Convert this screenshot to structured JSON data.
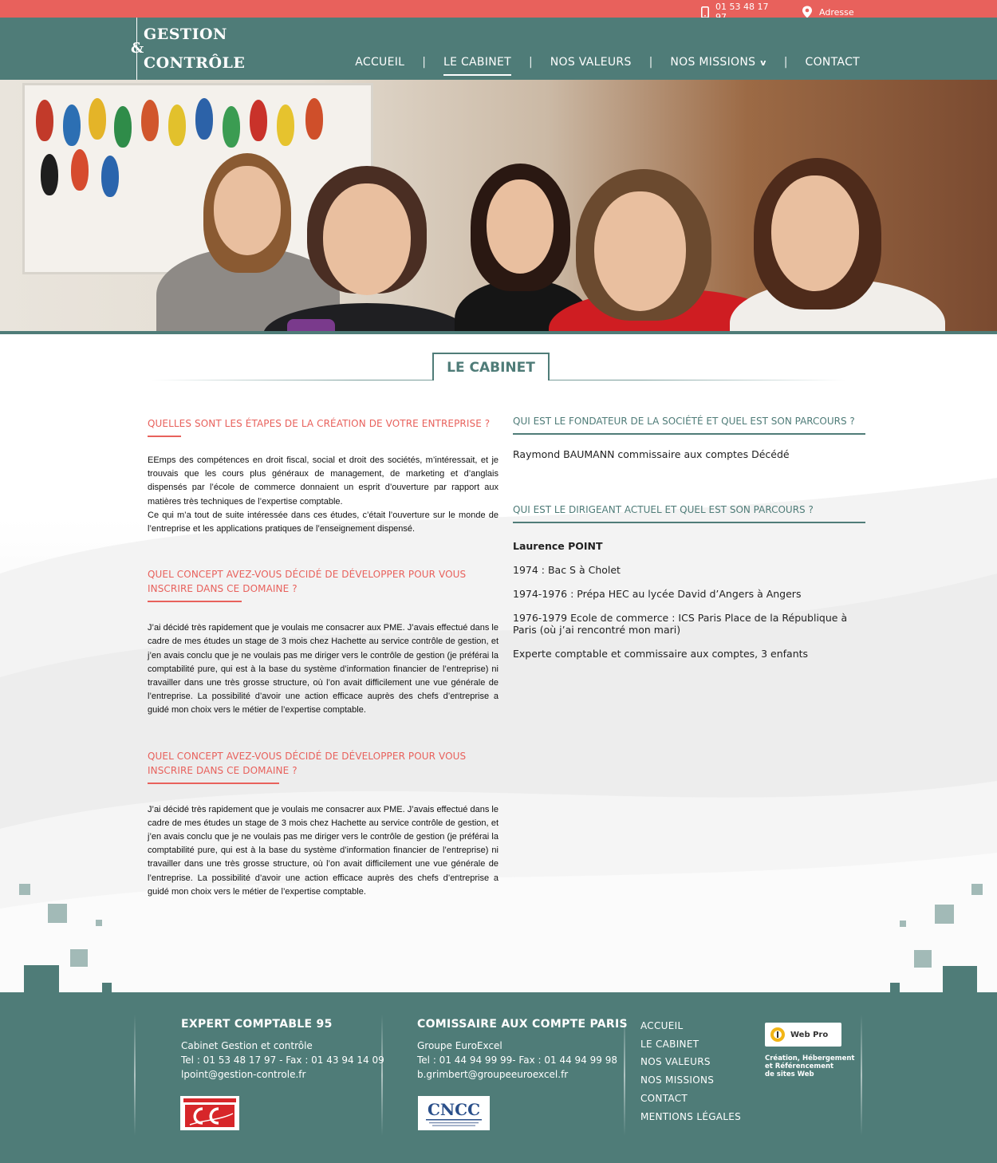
{
  "colors": {
    "accent_red": "#e8615c",
    "brand_teal": "#4f7c78"
  },
  "topbar": {
    "phone": "01 53 48 17 97",
    "address_label": "Adresse",
    "phone_icon": "mobile-phone-icon",
    "address_icon": "map-pin-icon"
  },
  "logo": {
    "line1": "GESTION",
    "amp": "&",
    "line2": "CONTRÔLE"
  },
  "nav": {
    "items": [
      {
        "label": "ACCUEIL"
      },
      {
        "label": "LE CABINET"
      },
      {
        "label": "NOS VALEURS"
      },
      {
        "label": "NOS MISSIONS"
      },
      {
        "label": "CONTACT"
      }
    ],
    "separator": "|",
    "dropdown_caret": "v",
    "active": "LE CABINET"
  },
  "section": {
    "title": "LE CABINET"
  },
  "left": {
    "blocks": [
      {
        "question": "QUELLES SONT LES ÉTAPES DE LA CRÉATION DE VOTRE ENTREPRISE ?",
        "text1": "EEmps des compétences en droit fiscal, social et droit des sociétés, m’intéressait, et je trouvais que les cours plus généraux de management, de marketing et d’anglais dispensés par l’école de commerce donnaient un esprit d’ouverture par rapport aux matières très techniques de l’expertise comptable.",
        "text2": "Ce qui m’a tout de suite intéressée dans ces études, c’était l’ouverture sur le monde de l’entreprise et les applications pratiques de l’enseignement dispensé."
      },
      {
        "question": "QUEL CONCEPT AVEZ-VOUS DÉCIDÉ DE DÉVELOPPER POUR VOUS INSCRIRE DANS CE DOMAINE ?",
        "text1": "J’ai décidé très rapidement que je voulais me consacrer aux PME. J’avais effectué dans le cadre de mes études un stage de 3 mois chez Hachette au service contrôle de gestion, et j’en avais conclu que je ne voulais pas me diriger vers le contrôle de gestion (je préférai la comptabilité pure, qui est à la base du système d’information financier de l’entreprise) ni travailler dans une très grosse structure, où l’on avait difficilement une vue générale de l’entreprise. La possibilité d’avoir une action efficace auprès des chefs d’entreprise a guidé mon choix vers le métier de l’expertise comptable."
      },
      {
        "question": "QUEL CONCEPT AVEZ-VOUS DÉCIDÉ DE DÉVELOPPER POUR VOUS INSCRIRE DANS CE DOMAINE ?",
        "text1": "J’ai décidé très rapidement que je voulais me consacrer aux PME. J’avais effectué dans le cadre de mes études un stage de 3 mois chez Hachette au service contrôle de gestion, et j’en avais conclu que je ne voulais pas me diriger vers le contrôle de gestion (je préférai la comptabilité pure, qui est à la base du système d’information financier de l’entreprise) ni travailler dans une très grosse structure, où l’on avait difficilement une vue générale de l’entreprise. La possibilité d’avoir une action efficace auprès des chefs d’entreprise a guidé mon choix vers le métier de l’expertise comptable."
      }
    ]
  },
  "right": {
    "founder_question": "QUI EST LE FONDATEUR DE LA SOCIÉTÉ ET QUEL EST SON PARCOURS ?",
    "founder_text": "Raymond BAUMANN commissaire aux comptes Décédé",
    "leader_question": "QUI EST LE DIRIGEANT ACTUEL ET QUEL EST SON PARCOURS ?",
    "leader_name": "Laurence POINT",
    "timeline": [
      "1974 : Bac S à Cholet",
      "1974-1976 : Prépa HEC au lycée David d’Angers à Angers",
      "1976-1979 Ecole de commerce : ICS Paris Place de la République à Paris (où j’ai rencontré mon mari)",
      "Experte comptable et commissaire aux comptes, 3 enfants"
    ]
  },
  "footer": {
    "col1": {
      "title": "EXPERT COMPTABLE 95",
      "name": "Cabinet Gestion et contrôle",
      "phones": "Tel : 01 53 48 17 97 - Fax : 01 43 94 14 09",
      "email": "lpoint@gestion-controle.fr",
      "badge_icon": "ordre-experts-comptables-logo"
    },
    "col2": {
      "title": "COMISSAIRE AUX COMPTE PARIS",
      "name": "Groupe EuroExcel",
      "phones": "Tel : 01 44 94 99 99- Fax : 01 44 94 99 98",
      "email": "b.grimbert@groupeeuroexcel.fr",
      "badge_icon": "cncc-logo"
    },
    "links": [
      "ACCUEIL",
      "LE CABINET",
      "NOS VALEURS",
      "NOS MISSIONS",
      "CONTACT",
      "MENTIONS LÉGALES"
    ],
    "webpro": {
      "label": "Web Pro",
      "icon": "webpro-logo",
      "caption1": "Création, Hébergement",
      "caption2": "et Référencement",
      "caption3": "de sites Web"
    }
  }
}
